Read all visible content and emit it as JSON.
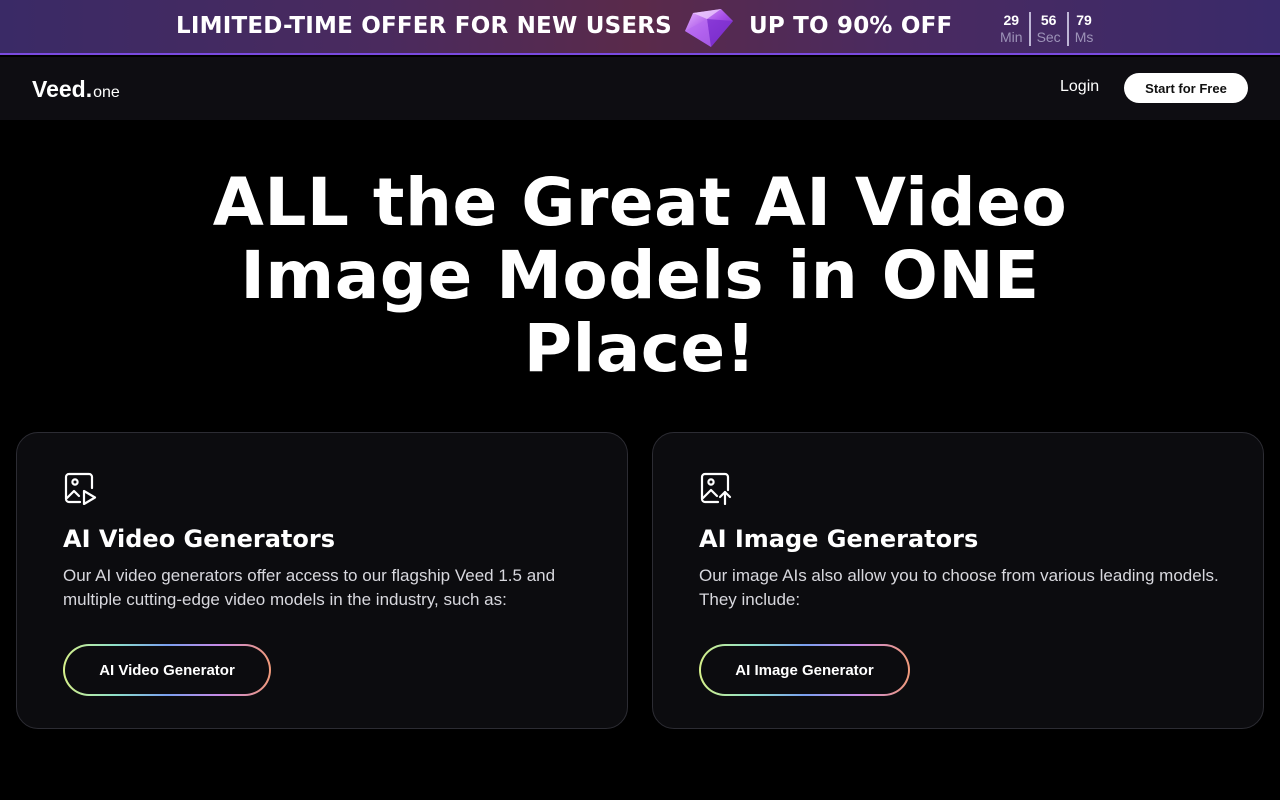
{
  "promo": {
    "left_text": "LIMITED-TIME OFFER FOR NEW USERS",
    "right_text": "UP TO 90% OFF",
    "gem_icon": "diamond-gem-icon",
    "timer": [
      {
        "value": "29",
        "label": "Min"
      },
      {
        "value": "56",
        "label": "Sec"
      },
      {
        "value": "79",
        "label": "Ms"
      }
    ]
  },
  "nav": {
    "logo_main": "Veed",
    "logo_dot": ".",
    "logo_sub": "one",
    "login": "Login",
    "start": "Start for Free"
  },
  "hero": {
    "title": "ALL the Great AI Video Image Models in ONE Place!"
  },
  "cards": [
    {
      "icon": "video-image-icon",
      "title": "AI Video Generators",
      "description": "Our AI video generators offer access to our flagship Veed 1.5 and multiple cutting-edge video models in the industry, such as:",
      "button": "AI Video Generator"
    },
    {
      "icon": "image-upload-icon",
      "title": "AI Image Generators",
      "description": "Our image AIs also allow you to choose from various leading models. They include:",
      "button": "AI Image Generator"
    }
  ],
  "colors": {
    "background": "#000000",
    "nav_bg": "#0e0d12",
    "card_bg": "#0c0c0f",
    "banner_accent": "#7a4ae0"
  }
}
